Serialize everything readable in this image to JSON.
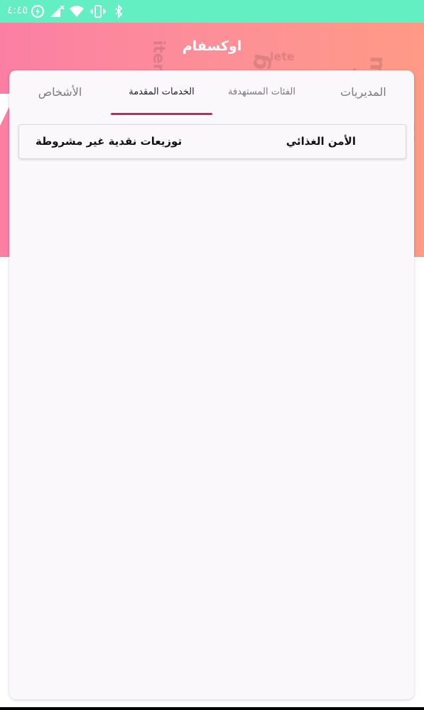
{
  "status_bar": {
    "time": "٤:٤٥",
    "icons": [
      "data-saver-icon",
      "signal-icon",
      "wifi-icon",
      "vibrate-icon",
      "bluetooth-icon"
    ]
  },
  "app": {
    "title": "اوكسفام"
  },
  "tabs": [
    {
      "label": "المديريات",
      "selected": false
    },
    {
      "label": "الفئات المستهدفة",
      "selected": false
    },
    {
      "label": "الخدمات المقدمة",
      "selected": true
    },
    {
      "label": "الأشخاص",
      "selected": false
    }
  ],
  "services": {
    "rows": [
      {
        "sector": "الأمن الغذائي",
        "activity": "توزيعات نقدية غير مشروطة"
      }
    ]
  },
  "colors": {
    "status_bar": "#63efc1",
    "header_start": "#fb7fa3",
    "header_end": "#fe9a85",
    "tab_indicator": "#c6285a",
    "card": "#fbf8fb"
  }
}
